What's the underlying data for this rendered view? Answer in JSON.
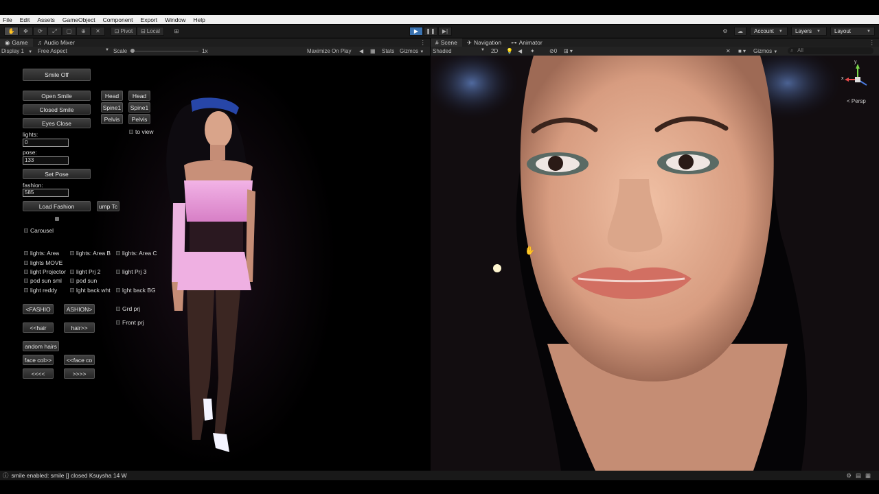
{
  "menu": [
    "File",
    "Edit",
    "Assets",
    "GameObject",
    "Component",
    "Export",
    "Window",
    "Help"
  ],
  "toolbar": {
    "tools": [
      "hand-tool-icon",
      "move-tool-icon",
      "rotate-tool-icon",
      "scale-tool-icon",
      "rect-tool-icon",
      "transform-tool-icon",
      "custom-tool-icon"
    ],
    "pivot": "Pivot",
    "local": "Local",
    "account": "Account",
    "layers": "Layers",
    "layout": "Layout"
  },
  "game_panel": {
    "tabs": [
      "Game",
      "Audio Mixer"
    ],
    "display": "Display 1",
    "aspect": "Free Aspect",
    "scale_label": "Scale",
    "scale_value": "1x",
    "maximize": "Maximize On Play",
    "stats": "Stats",
    "gizmos": "Gizmos"
  },
  "scene_panel": {
    "tabs": [
      "Scene",
      "Navigation",
      "Animator"
    ],
    "shading": "Shaded",
    "mode_2d": "2D",
    "hidden_count": "0",
    "gizmos": "Gizmos",
    "search": "All",
    "persp": "Persp",
    "axis_y": "y",
    "axis_x": "x"
  },
  "gui": {
    "smile_off": "Smile Off",
    "open_smile": "Open Smile",
    "closed_smile": "Closed Smile",
    "eyes_close": "Eyes Close",
    "lights_label": "lights:",
    "lights_value": "0",
    "pose_label": "pose:",
    "pose_value": "133",
    "set_pose": "Set Pose",
    "fashion_label": "fashion:",
    "fashion_value": "585",
    "load_fashion": "Load Fashion",
    "jump": "ump Tc",
    "head_a": "Head",
    "head_b": "Head",
    "spine_a": "Spine1",
    "spine_b": "Spine1",
    "pelvis_a": "Pelvis",
    "pelvis_b": "Pelvis",
    "to_view": "to view",
    "carousel": "Carousel",
    "lights_area": "lights: Area",
    "lights_area_b": "lights: Area B",
    "lights_area_c": "lights: Area C",
    "lights_move": "lights MOVE",
    "light_projector": "light Projector",
    "light_prj2": "light Prj 2",
    "light_prj3": "light Prj 3",
    "pod_sun_sml": "pod sun sml",
    "pod_sun": "pod sun",
    "light_reddy": "light reddy",
    "lght_back_wht": "lght back wht",
    "lght_back_bg": "lght back BG",
    "grd_prj": "Grd prj",
    "front_prj": "Front prj",
    "fashion_prev": "<FASHIO",
    "fashion_next": "ASHION>",
    "hair_prev": "<<hair",
    "hair_next": "hair>>",
    "random_hairs": "andom hairs",
    "face_col_next": "face col>>",
    "face_col_prev": "<<face co",
    "far_prev": "<<<<",
    "far_next": ">>>>"
  },
  "status": "smile enabled: smile [] closed Ksuysha 14 W"
}
